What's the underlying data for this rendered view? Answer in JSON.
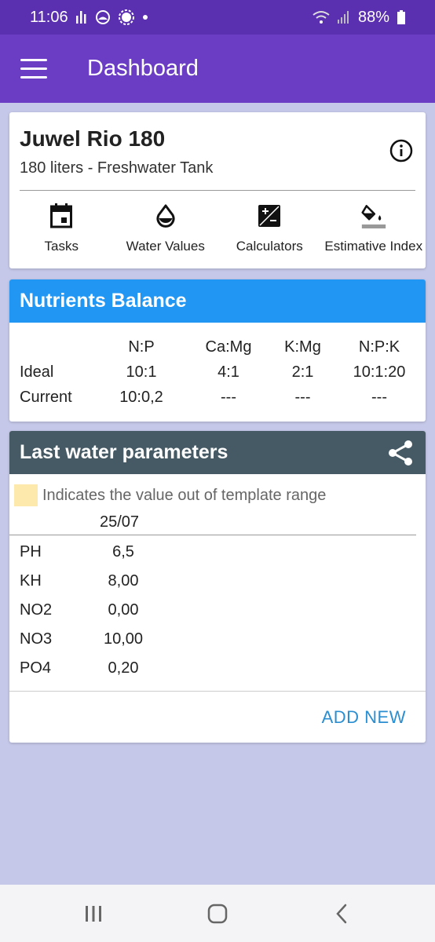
{
  "status": {
    "time": "11:06",
    "battery": "88%"
  },
  "app_bar": {
    "title": "Dashboard"
  },
  "tank": {
    "name": "Juwel Rio 180",
    "subtitle": "180 liters - Freshwater Tank",
    "actions": [
      {
        "label": "Tasks",
        "icon": "calendar-icon"
      },
      {
        "label": "Water Values",
        "icon": "water-drop-icon"
      },
      {
        "label": "Calculators",
        "icon": "calculator-icon"
      },
      {
        "label": "Estimative Index",
        "icon": "paint-bucket-icon"
      }
    ]
  },
  "nutrients": {
    "title": "Nutrients Balance",
    "headers": [
      "",
      "N:P",
      "Ca:Mg",
      "K:Mg",
      "N:P:K"
    ],
    "rows": [
      [
        "Ideal",
        "10:1",
        "4:1",
        "2:1",
        "10:1:20"
      ],
      [
        "Current",
        "10:0,2",
        "---",
        "---",
        "---"
      ]
    ]
  },
  "water": {
    "title": "Last water parameters",
    "legend": "Indicates the value out of template range",
    "legend_color": "#fde9ab",
    "date": "25/07",
    "params": [
      {
        "name": "PH",
        "value": "6,5"
      },
      {
        "name": "KH",
        "value": "8,00"
      },
      {
        "name": "NO2",
        "value": "0,00"
      },
      {
        "name": "NO3",
        "value": "10,00"
      },
      {
        "name": "PO4",
        "value": "0,20"
      }
    ],
    "add_new": "ADD NEW"
  },
  "colors": {
    "status_bar": "#5a2fb0",
    "app_bar": "#6a3dc4",
    "nutrients_header": "#2196f3",
    "water_header": "#455a64",
    "accent_link": "#2a8ed0"
  }
}
